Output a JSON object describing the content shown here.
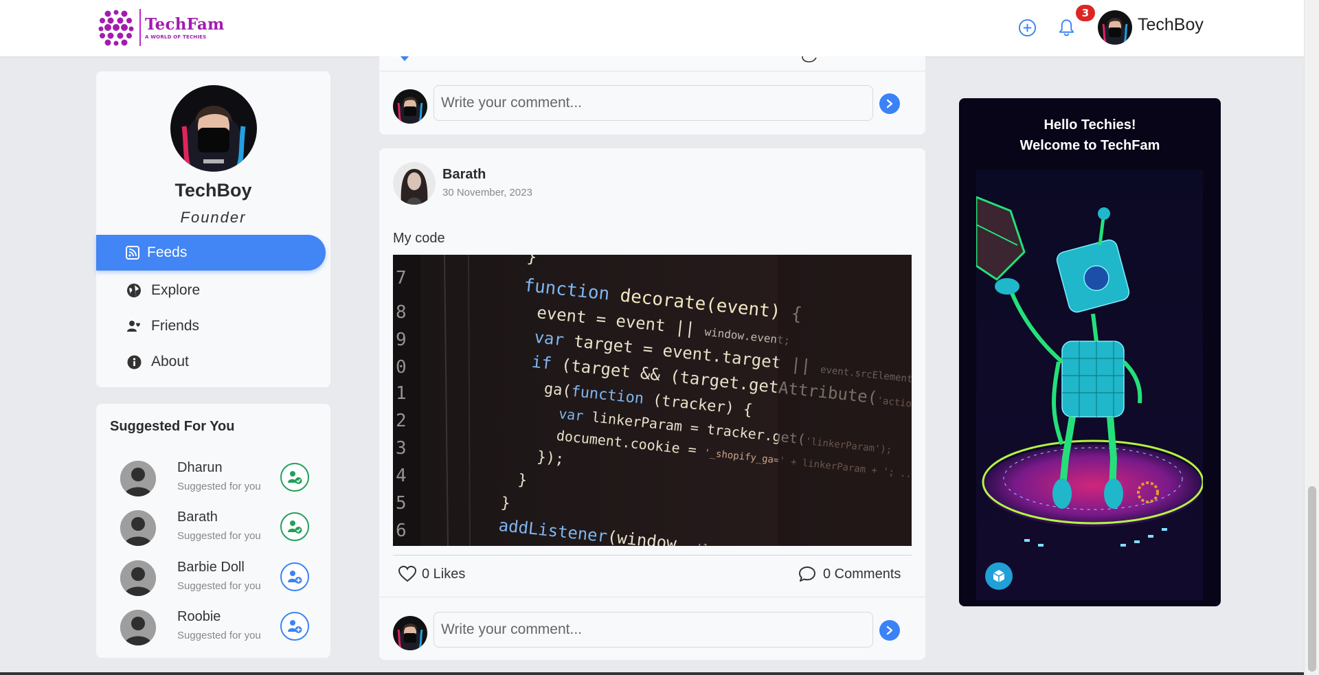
{
  "header": {
    "logo_title": "TechFam",
    "logo_subtitle": "A WORLD OF TECHIES",
    "notification_count": "3",
    "username": "TechBoy"
  },
  "profile": {
    "name": "TechBoy",
    "role": "Founder"
  },
  "nav": {
    "items": [
      {
        "label": "Feeds",
        "icon": "rss-icon",
        "active": true
      },
      {
        "label": "Explore",
        "icon": "globe-icon",
        "active": false
      },
      {
        "label": "Friends",
        "icon": "friends-icon",
        "active": false
      },
      {
        "label": "About",
        "icon": "info-icon",
        "active": false
      }
    ]
  },
  "suggestions": {
    "title": "Suggested For You",
    "items": [
      {
        "name": "Dharun",
        "subtitle": "Suggested for you",
        "action": "friend-check-icon"
      },
      {
        "name": "Barath",
        "subtitle": "Suggested for you",
        "action": "friend-check-icon"
      },
      {
        "name": "Barbie Doll",
        "subtitle": "Suggested for you",
        "action": "add-friend-icon"
      },
      {
        "name": "Roobie",
        "subtitle": "Suggested for you",
        "action": "add-friend-icon"
      }
    ]
  },
  "feed": {
    "comment_placeholder": "Write your comment...",
    "post": {
      "author": "Barath",
      "date": "30 November, 2023",
      "text": "My code",
      "likes_label": "0 Likes",
      "comments_label": "0 Comments"
    }
  },
  "ad": {
    "line1": "Hello Techies!",
    "line2": "Welcome to TechFam"
  },
  "colors": {
    "accent": "#4285f4",
    "brand": "#a21caf",
    "badge": "#dc2626",
    "friend_green": "#22a05a"
  }
}
